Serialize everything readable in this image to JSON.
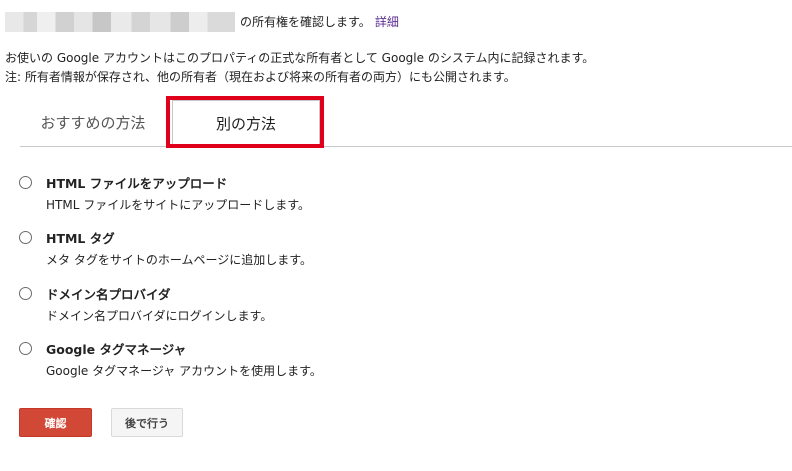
{
  "header": {
    "title_suffix": "の所有権を確認します。",
    "details_link": "詳細"
  },
  "description": {
    "line1": "お使いの Google アカウントはこのプロパティの正式な所有者として Google のシステム内に記録されます。",
    "line2": "注: 所有者情報が保存され、他の所有者（現在および将来の所有者の両方）にも公開されます。"
  },
  "tabs": [
    {
      "label": "おすすめの方法",
      "active": false
    },
    {
      "label": "別の方法",
      "active": true
    }
  ],
  "options": [
    {
      "title": "HTML ファイルをアップロード",
      "desc": "HTML ファイルをサイトにアップロードします。"
    },
    {
      "title": "HTML タグ",
      "desc": "メタ タグをサイトのホームページに追加します。"
    },
    {
      "title": "ドメイン名プロバイダ",
      "desc": "ドメイン名プロバイダにログインします。"
    },
    {
      "title": "Google タグマネージャ",
      "desc": "Google タグマネージャ アカウントを使用します。"
    }
  ],
  "buttons": {
    "confirm": "確認",
    "later": "後で行う"
  },
  "colors": {
    "confirm_bg": "#d14836",
    "highlight_border": "#e0001b",
    "link": "#5a2d91"
  }
}
